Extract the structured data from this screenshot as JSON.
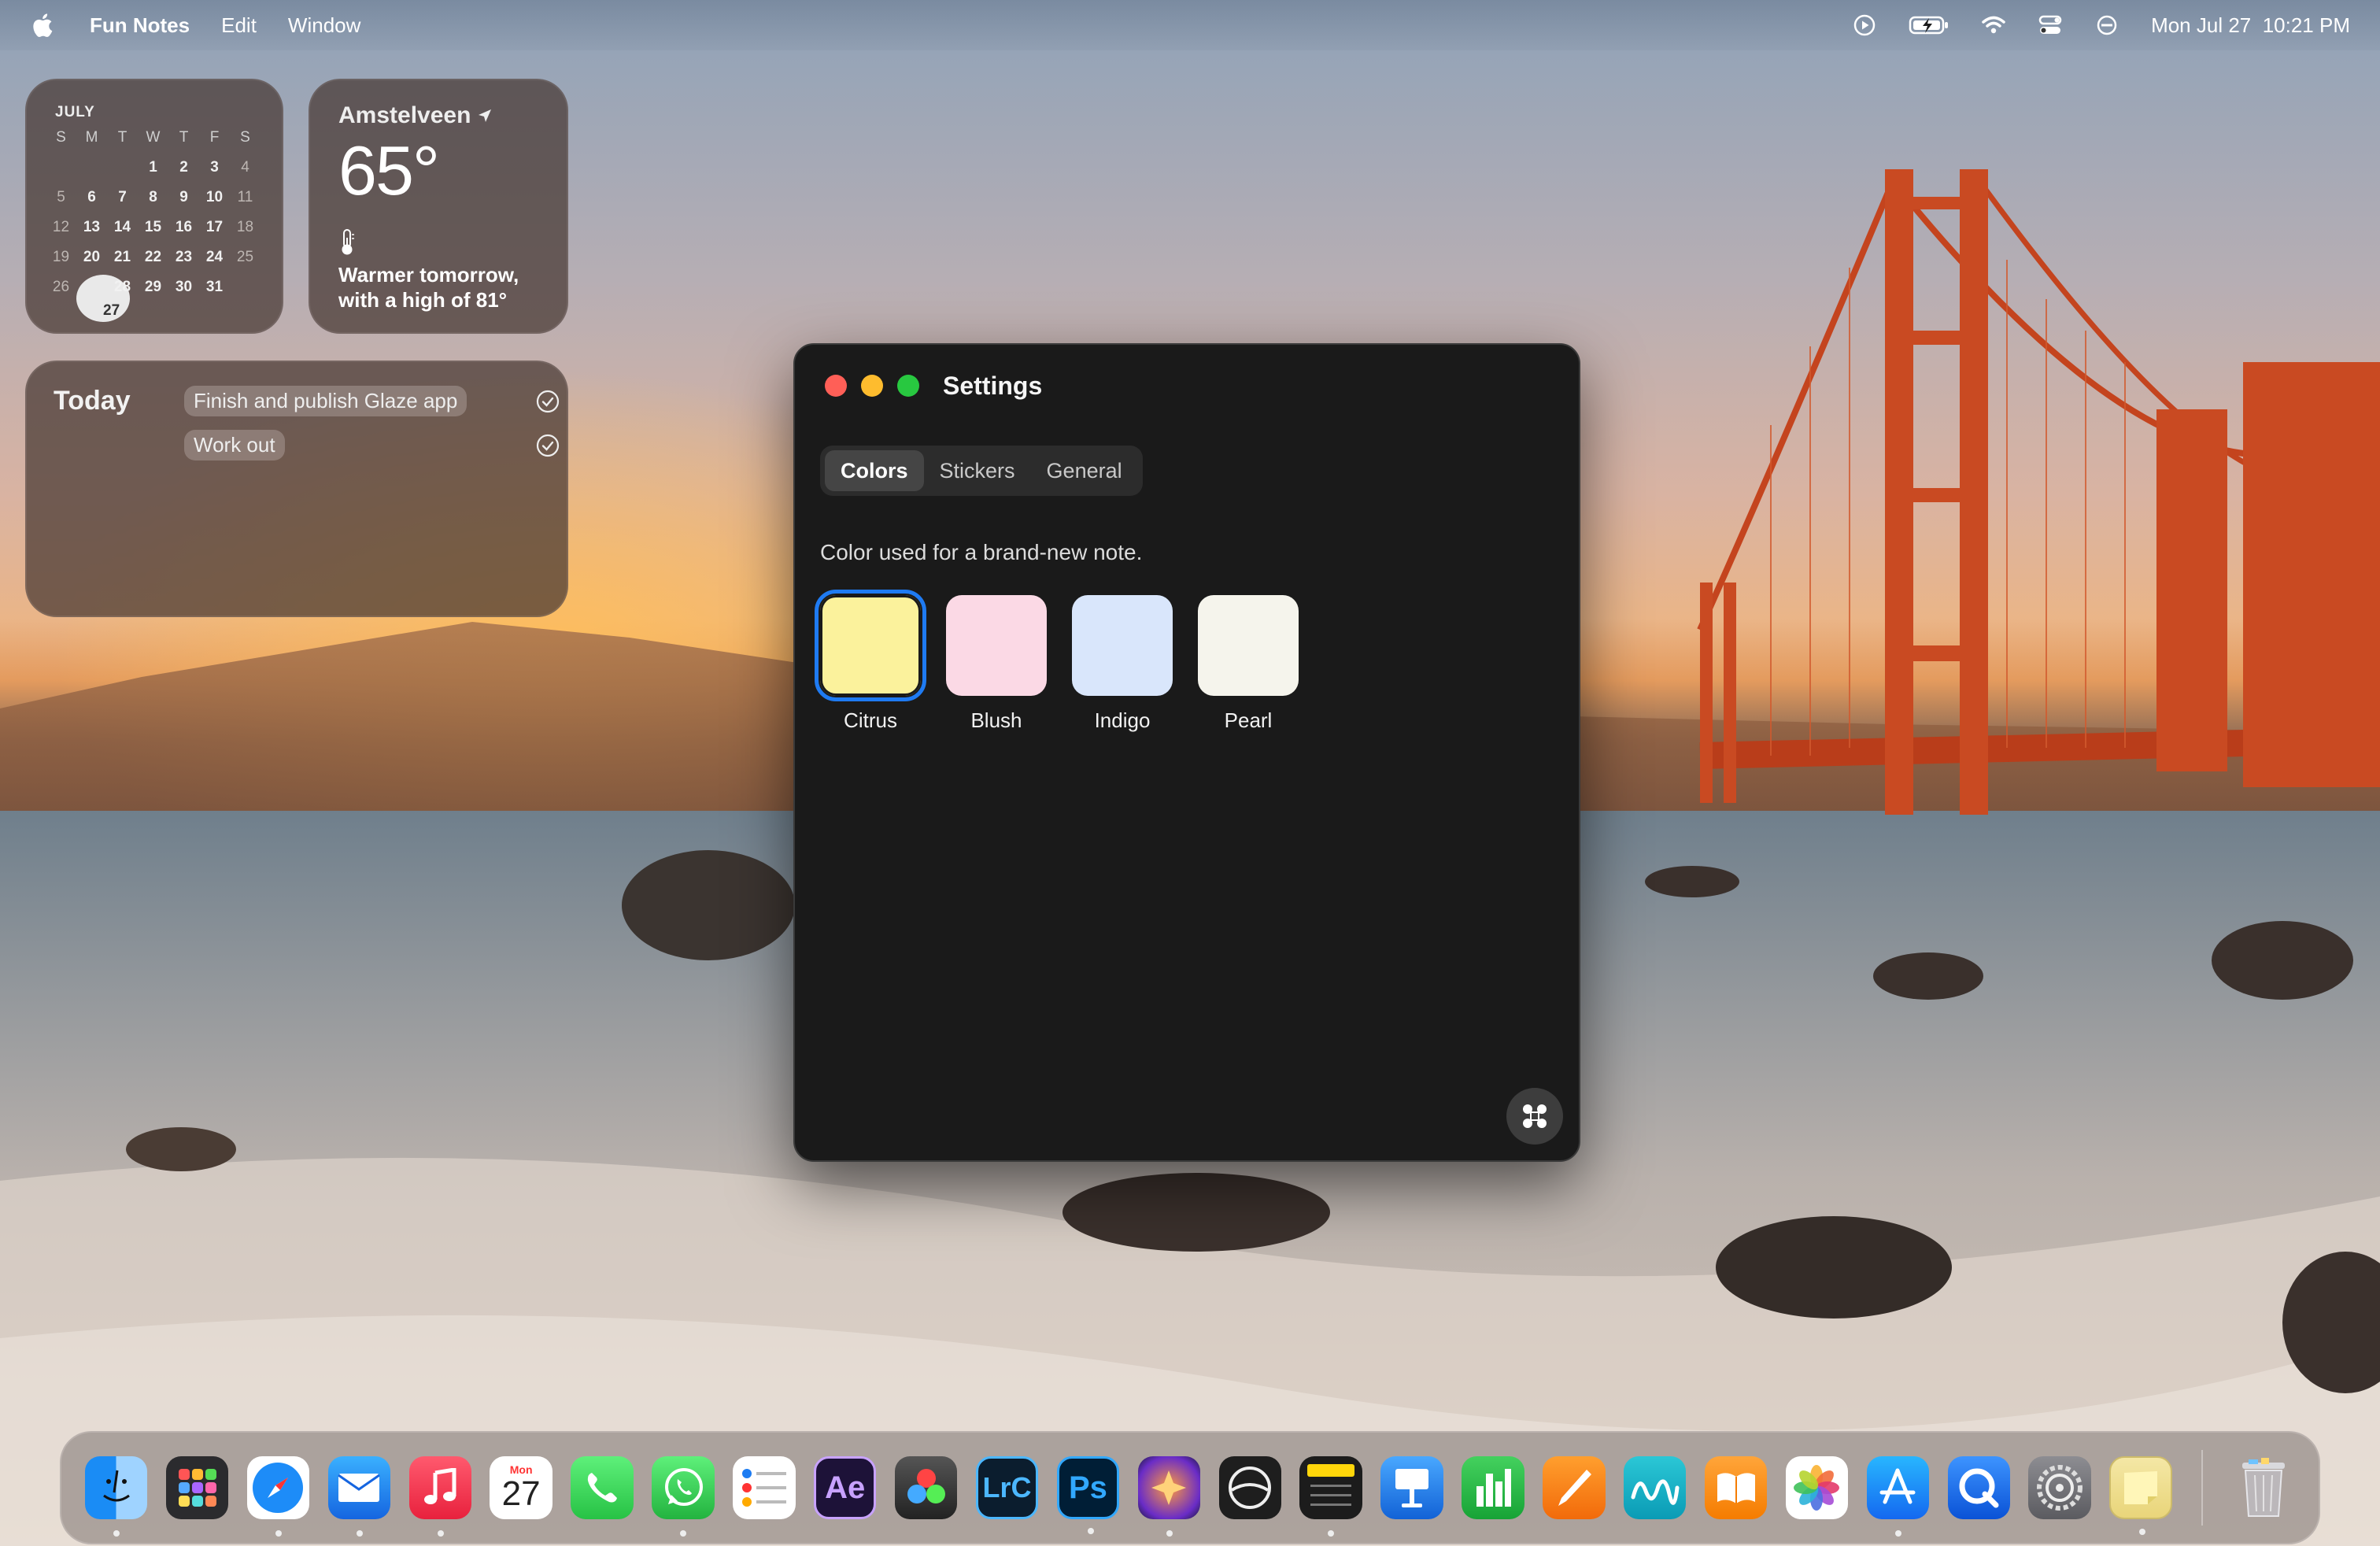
{
  "menubar": {
    "app_name": "Fun Notes",
    "menus": [
      "Edit",
      "Window"
    ],
    "date": "Mon Jul 27",
    "time": "10:21 PM",
    "status_icons": [
      "play-circle-icon",
      "battery-charging-icon",
      "wifi-icon",
      "control-center-icon",
      "focus-icon"
    ]
  },
  "calendar_widget": {
    "month": "JULY",
    "weekdays": [
      "S",
      "M",
      "T",
      "W",
      "T",
      "F",
      "S"
    ],
    "weeks": [
      [
        "",
        "",
        "",
        "1",
        "2",
        "3",
        "4"
      ],
      [
        "5",
        "6",
        "7",
        "8",
        "9",
        "10",
        "11"
      ],
      [
        "12",
        "13",
        "14",
        "15",
        "16",
        "17",
        "18"
      ],
      [
        "19",
        "20",
        "21",
        "22",
        "23",
        "24",
        "25"
      ],
      [
        "26",
        "27",
        "28",
        "29",
        "30",
        "31",
        ""
      ]
    ],
    "today": "27"
  },
  "weather_widget": {
    "city": "Amstelveen",
    "temperature": "65°",
    "forecast_line1": "Warmer tomorrow,",
    "forecast_line2": "with a high of 81°"
  },
  "today_widget": {
    "title": "Today",
    "tasks": [
      {
        "label": "Finish and publish Glaze app",
        "done": false
      },
      {
        "label": "Work out",
        "done": false
      }
    ]
  },
  "settings_window": {
    "title": "Settings",
    "tabs": [
      {
        "label": "Colors",
        "active": true
      },
      {
        "label": "Stickers",
        "active": false
      },
      {
        "label": "General",
        "active": false
      }
    ],
    "description": "Color used for a brand-new note.",
    "swatches": [
      {
        "label": "Citrus",
        "color": "#fbf29c",
        "selected": true
      },
      {
        "label": "Blush",
        "color": "#fbd9e5",
        "selected": false
      },
      {
        "label": "Indigo",
        "color": "#d9e6fb",
        "selected": false
      },
      {
        "label": "Pearl",
        "color": "#f5f4ec",
        "selected": false
      }
    ],
    "fab_icon": "move-icon"
  },
  "dock": {
    "calendar_icon_month": "Mon",
    "calendar_icon_day": "27",
    "apps": [
      {
        "name": "finder",
        "running": true
      },
      {
        "name": "launchpad",
        "running": false
      },
      {
        "name": "safari",
        "running": true
      },
      {
        "name": "mail",
        "running": true
      },
      {
        "name": "music",
        "running": true
      },
      {
        "name": "calendar",
        "running": false
      },
      {
        "name": "phone",
        "running": false
      },
      {
        "name": "whatsapp",
        "running": true
      },
      {
        "name": "reminders",
        "running": false
      },
      {
        "name": "after-effects",
        "label": "Ae",
        "running": false
      },
      {
        "name": "davinci-resolve",
        "running": false
      },
      {
        "name": "lightroom-classic",
        "label": "LrC",
        "running": false
      },
      {
        "name": "photoshop",
        "label": "Ps",
        "running": true
      },
      {
        "name": "pixelmator",
        "running": true
      },
      {
        "name": "lasso-app",
        "running": false
      },
      {
        "name": "notes-black",
        "running": true
      },
      {
        "name": "keynote",
        "running": false
      },
      {
        "name": "numbers",
        "running": false
      },
      {
        "name": "pages",
        "running": false
      },
      {
        "name": "freeform",
        "running": false
      },
      {
        "name": "books",
        "running": false
      },
      {
        "name": "photos",
        "running": false
      },
      {
        "name": "app-store",
        "running": true
      },
      {
        "name": "quicktime",
        "running": false
      },
      {
        "name": "system-settings",
        "running": false
      },
      {
        "name": "fun-notes",
        "running": true
      },
      {
        "name": "trash",
        "running": false
      }
    ]
  }
}
